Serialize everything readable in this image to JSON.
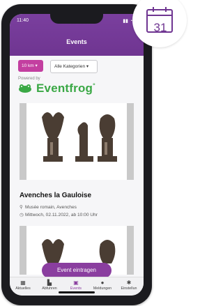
{
  "status_bar": {
    "time": "11:40",
    "icons": "▮▮ ◔ ▮"
  },
  "header": {
    "title": "Events"
  },
  "filters": {
    "distance": "10 km ▾",
    "category": "Alle Kategorien ▾"
  },
  "powered_by": {
    "label": "Powered by",
    "brand": "Eventfrog",
    "brand_mark": "°"
  },
  "event": {
    "title": "Avenches la Gauloise",
    "location": "Musée romain, Avenches",
    "datetime": "Mittwoch, 02.11.2022, ab 10:00 Uhr",
    "icons": {
      "location": "location-pin-icon",
      "time": "clock-icon"
    }
  },
  "cta_label": "Event eintragen",
  "tabs": [
    {
      "label": "Aktuelles",
      "icon": "home-icon"
    },
    {
      "label": "Abfuhren",
      "icon": "truck-icon"
    },
    {
      "label": "Events",
      "icon": "calendar-icon",
      "active": true
    },
    {
      "label": "Meldungen",
      "icon": "megaphone-icon"
    },
    {
      "label": "Einstellun",
      "icon": "gear-icon"
    }
  ],
  "calendar_badge": {
    "day": "31",
    "icon": "calendar-icon"
  },
  "colors": {
    "primary": "#7a3f9e",
    "accent": "#c33fa0",
    "brand_green": "#3aa845"
  }
}
